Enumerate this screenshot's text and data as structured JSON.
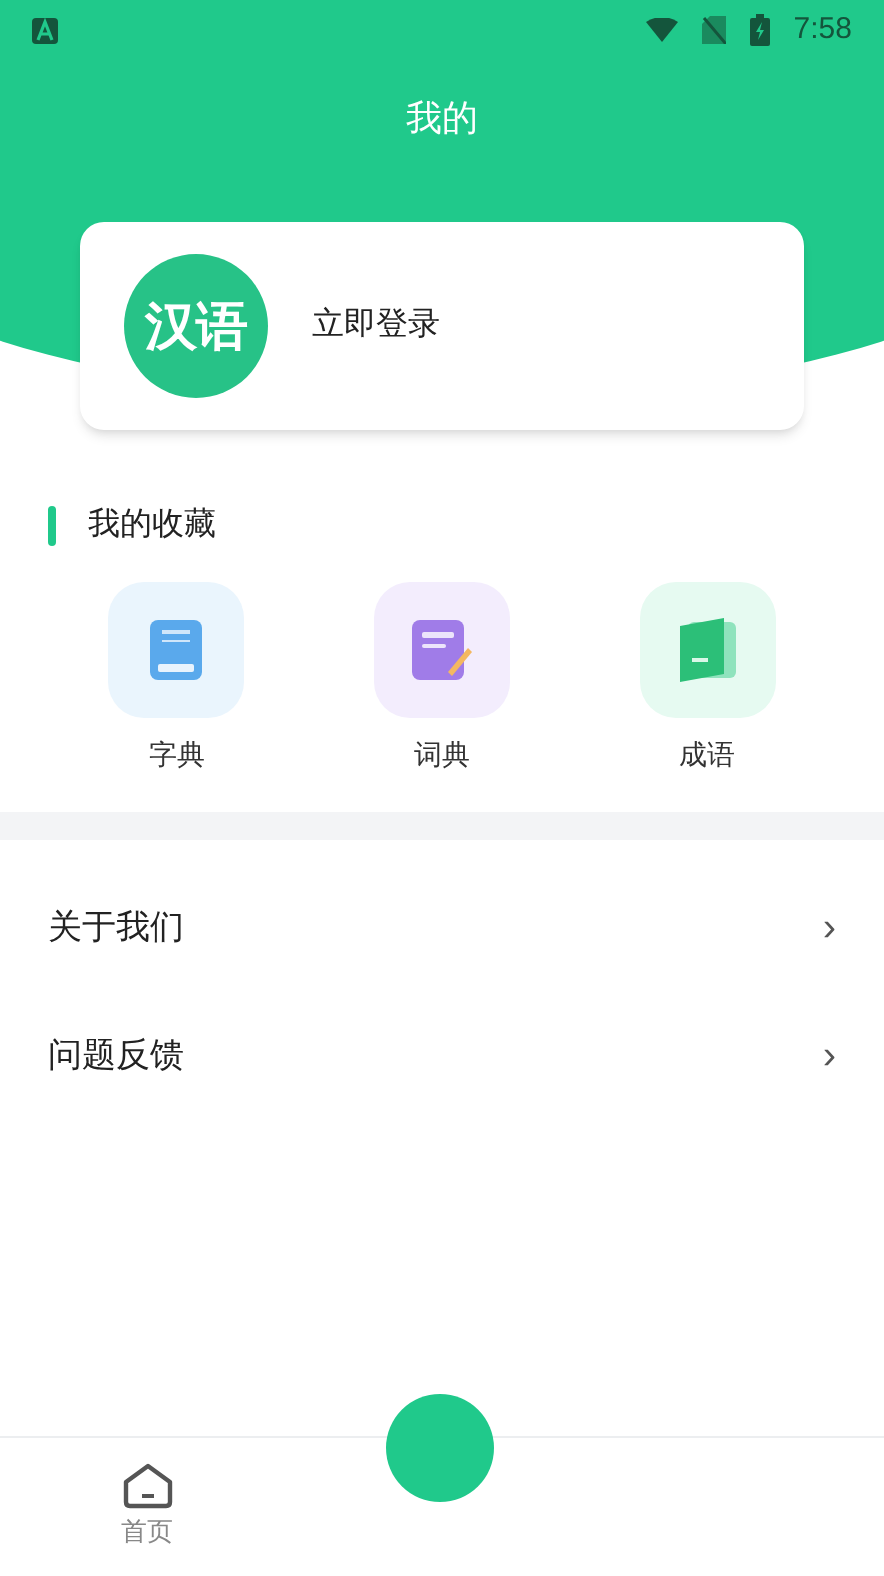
{
  "status_bar": {
    "time": "7:58"
  },
  "header": {
    "title": "我的"
  },
  "login_card": {
    "logo_text": "汉语",
    "label": "立即登录"
  },
  "favorites": {
    "title": "我的收藏",
    "items": [
      {
        "kind": "zidian",
        "label": "字典"
      },
      {
        "kind": "cidian",
        "label": "词典"
      },
      {
        "kind": "chengyu",
        "label": "成语"
      }
    ]
  },
  "menu": [
    {
      "label": "关于我们",
      "chevron": "›"
    },
    {
      "label": "问题反馈",
      "chevron": "›"
    }
  ],
  "bottom_nav": {
    "tabs": [
      {
        "label": "首页",
        "selected": false
      }
    ]
  }
}
